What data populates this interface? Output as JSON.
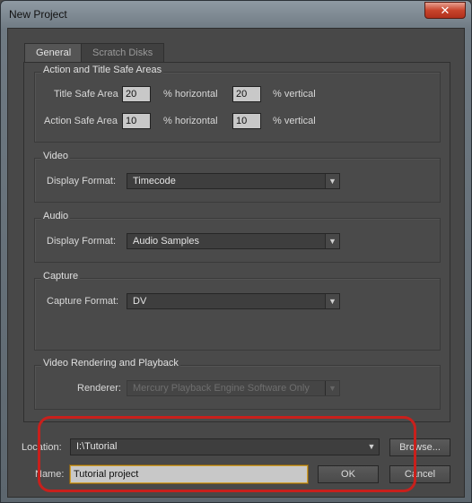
{
  "window": {
    "title": "New Project",
    "close_symbol": "✕"
  },
  "tabs": [
    {
      "label": "General",
      "active": true
    },
    {
      "label": "Scratch Disks",
      "active": false
    }
  ],
  "safe_areas": {
    "group_title": "Action and Title Safe Areas",
    "title_safe_label": "Title Safe Area",
    "title_h": "20",
    "title_v": "20",
    "action_safe_label": "Action Safe Area",
    "action_h": "10",
    "action_v": "10",
    "horizontal_unit": "% horizontal",
    "vertical_unit": "% vertical"
  },
  "video": {
    "group_title": "Video",
    "label": "Display Format:",
    "value": "Timecode"
  },
  "audio": {
    "group_title": "Audio",
    "label": "Display Format:",
    "value": "Audio Samples"
  },
  "capture": {
    "group_title": "Capture",
    "label": "Capture Format:",
    "value": "DV"
  },
  "rendering": {
    "group_title": "Video Rendering and Playback",
    "label": "Renderer:",
    "value": "Mercury Playback Engine Software Only"
  },
  "location": {
    "label": "Location:",
    "value": "I:\\Tutorial",
    "browse_label": "Browse..."
  },
  "name": {
    "label": "Name:",
    "value": "Tutorial project"
  },
  "buttons": {
    "ok": "OK",
    "cancel": "Cancel"
  },
  "colors": {
    "annotation": "#c8201c",
    "background": "#484848"
  },
  "dropdown_arrow": "▼"
}
